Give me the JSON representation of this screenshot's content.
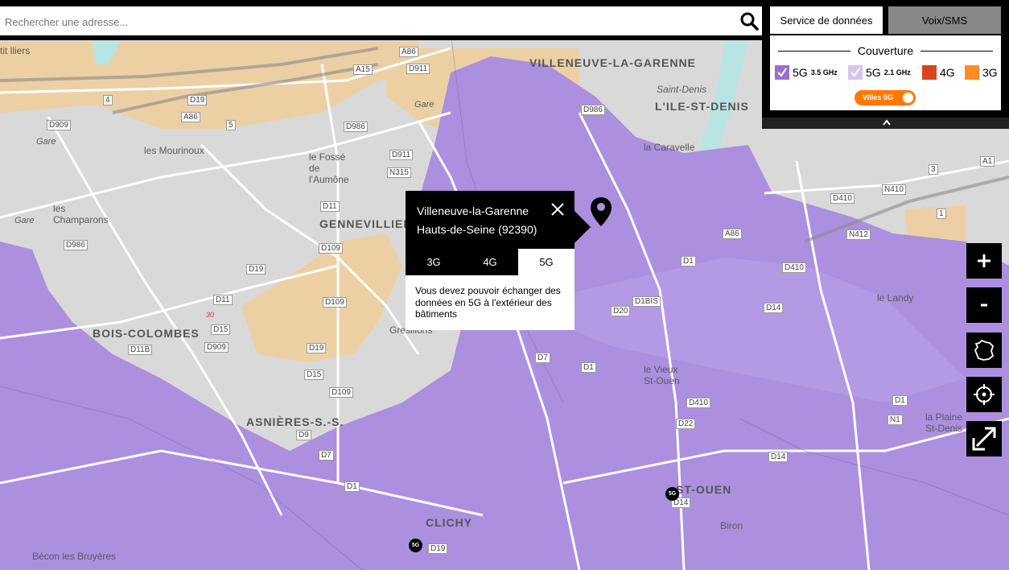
{
  "search": {
    "placeholder": "Rechercher une adresse..."
  },
  "panel": {
    "tabs": [
      {
        "label": "Service de données",
        "active": true
      },
      {
        "label": "Voix/SMS",
        "active": false
      }
    ],
    "coverage_title": "Couverture",
    "legend": [
      {
        "label": "5G",
        "sub": "3.5 GHz",
        "color": "#9b6fd1",
        "checked": true
      },
      {
        "label": "5G",
        "sub": "2.1 GHz",
        "color": "#d7c3f0",
        "checked": true
      },
      {
        "label": "4G",
        "color": "#d9451b",
        "checked": false
      },
      {
        "label": "3G",
        "color": "#ff8b24",
        "checked": false
      }
    ],
    "toggle_label": "Villes 5G",
    "toggle_on": true
  },
  "popup": {
    "city": "Villeneuve-la-Garenne",
    "department": "Hauts-de-Seine (92390)",
    "tabs": [
      "3G",
      "4G",
      "5G"
    ],
    "selected_tab": "5G",
    "message": "Vous devez pouvoir échanger des données en 5G à l'extérieur des bâtiments"
  },
  "controls": {
    "zoom_in": "+",
    "zoom_out": "-"
  },
  "map": {
    "cities": [
      "VILLENEUVE-LA-GARENNE",
      "L'ILE-ST-DENIS",
      "GENNEVILLIERS",
      "BOIS-COLOMBES",
      "ASNIÈRES-S.-S.",
      "CLICHY",
      "ST-OUEN"
    ],
    "places": [
      "les Mourinoux",
      "le Fossé de l'Aumône",
      "les Champarons",
      "la Caravelle",
      "Saint-Denis",
      "Gresillons",
      "le Vieux St-Ouen",
      "la Plaine St-Denis",
      "le Landy",
      "Bécon les Bruyères",
      "Biron",
      "Gare",
      "tit lliers",
      "Gare",
      "Gare"
    ],
    "roads": [
      "A86",
      "D911",
      "A15",
      "D19",
      "A86",
      "D909",
      "D986",
      "D911",
      "N315",
      "D11",
      "D109",
      "D986",
      "D19",
      "D109",
      "D11",
      "D15",
      "D909",
      "D11B",
      "D19",
      "D15",
      "D109",
      "D9",
      "D7",
      "D1",
      "D19",
      "D14",
      "N410",
      "N412",
      "D410",
      "A1",
      "N1",
      "D14",
      "D410",
      "D22",
      "D1",
      "D986",
      "D20",
      "D1BIS",
      "D7",
      "D1",
      "A86",
      "D1",
      "D14",
      "D410"
    ],
    "road_numbers": [
      "4",
      "5",
      "3",
      "1",
      "30"
    ],
    "badges": [
      "5G",
      "5G"
    ],
    "colors": {
      "coverage_35": "#ad8fe0",
      "coverage_21": "#c9b6ee",
      "land": "#d9d9d9",
      "industrial": "#ecd0a4",
      "water": "#b9e4e4"
    }
  }
}
